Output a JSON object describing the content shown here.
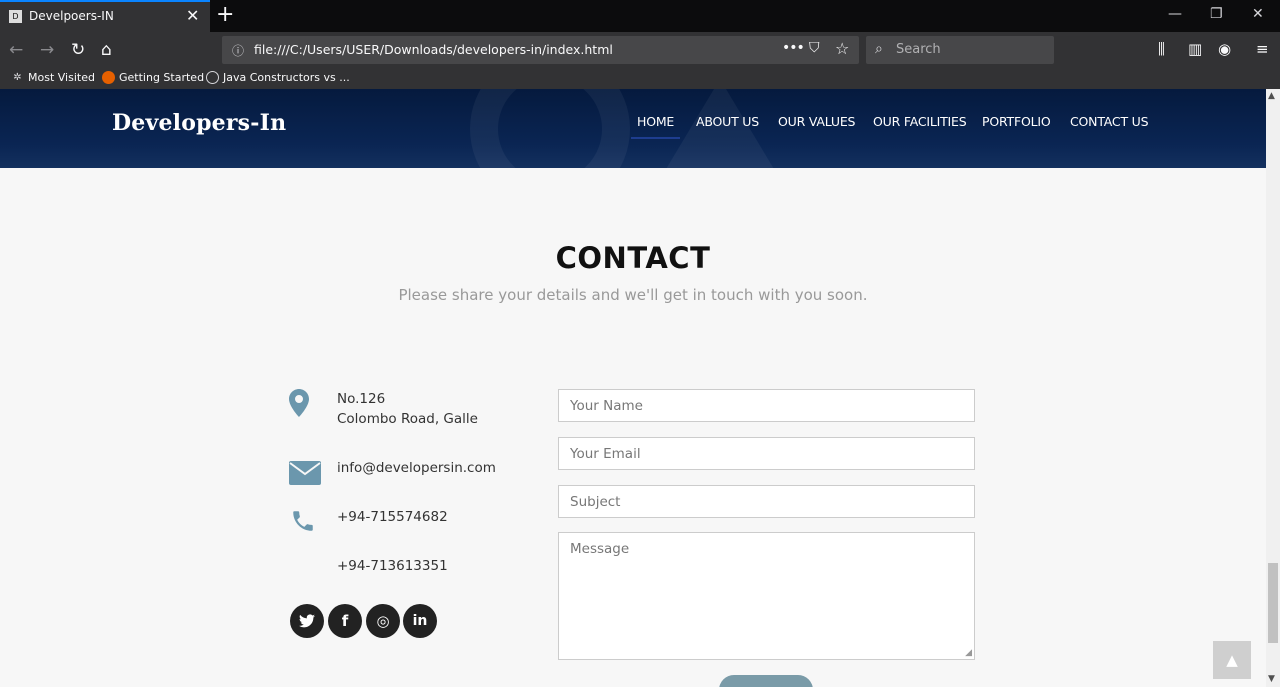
{
  "browser": {
    "tab_title": "Develpoers-IN",
    "tab_favicon_text": "D",
    "close_tab_glyph": "✕",
    "new_tab_glyph": "+",
    "window_controls": [
      "—",
      "❐",
      "✕"
    ],
    "url": "file:///C:/Users/USER/Downloads/developers-in/index.html",
    "search_placeholder": "Search",
    "bookmarks": [
      "Most Visited",
      "Getting Started",
      "Java Constructors vs ..."
    ]
  },
  "site": {
    "brand": "Developers-In",
    "nav": [
      "HOME",
      "ABOUT US",
      "OUR VALUES",
      "OUR FACILITIES",
      "PORTFOLIO",
      "CONTACT US"
    ],
    "active_nav": "HOME"
  },
  "contact": {
    "title": "CONTACT",
    "subtitle": "Please share your details and we'll get in touch with you soon.",
    "address_line1": "No.126",
    "address_line2": "Colombo Road, Galle",
    "email": "info@developersin.com",
    "phone1": "+94-715574682",
    "phone2": "+94-713613351",
    "social": [
      {
        "name": "twitter",
        "glyph": "🐦"
      },
      {
        "name": "facebook",
        "glyph": "f"
      },
      {
        "name": "instagram",
        "glyph": "◎"
      },
      {
        "name": "linkedin",
        "glyph": "in"
      }
    ],
    "form": {
      "name_placeholder": "Your Name",
      "email_placeholder": "Your Email",
      "subject_placeholder": "Subject",
      "message_placeholder": "Message"
    }
  },
  "colors": {
    "header_bg": "#0a2553",
    "icon_accent": "#6b97ad",
    "submit_bg": "#7a9ba8"
  }
}
